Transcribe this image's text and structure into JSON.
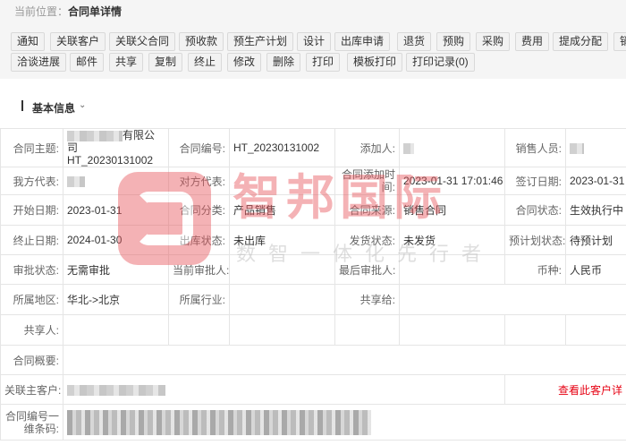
{
  "breadcrumb": {
    "prefix": "当前位置：",
    "current": "合同单详情"
  },
  "toolbar": {
    "row1": [
      "通知",
      "关联客户",
      "关联父合同",
      "预收款",
      "预生产计划",
      "设计",
      "出库申请",
      "退货",
      "预购",
      "采购",
      "费用",
      "提成分配",
      "销"
    ],
    "row2": [
      "洽谈进展",
      "邮件",
      "共享",
      "复制",
      "终止",
      "修改",
      "删除",
      "打印",
      "模板打印",
      "打印记录(0)"
    ]
  },
  "section": {
    "title": "基本信息",
    "chevron": "chevron-down-icon"
  },
  "fields": {
    "subject": {
      "label": "合同主题:",
      "value_visible": "有限公司",
      "value_line2": "HT_20230131002"
    },
    "contract_no": {
      "label": "合同编号:",
      "value": "HT_20230131002"
    },
    "creator": {
      "label": "添加人:"
    },
    "sales_person": {
      "label": "销售人员:"
    },
    "our_rep": {
      "label": "我方代表:"
    },
    "their_rep": {
      "label": "对方代表:"
    },
    "add_time": {
      "label": "合同添加时间:",
      "value": "2023-01-31 17:01:46"
    },
    "sign_date": {
      "label": "签订日期:",
      "value": "2023-01-31"
    },
    "start_date": {
      "label": "开始日期:",
      "value": "2023-01-31"
    },
    "category": {
      "label": "合同分类:",
      "value": "产品销售"
    },
    "source": {
      "label": "合同来源:",
      "value": "销售合同"
    },
    "status": {
      "label": "合同状态:",
      "value": "生效执行中"
    },
    "end_date": {
      "label": "终止日期:",
      "value": "2024-01-30"
    },
    "outbound_status": {
      "label": "出库状态:",
      "value": "未出库"
    },
    "shipping_status": {
      "label": "发货状态:",
      "value": "未发货"
    },
    "plan_status": {
      "label": "预计划状态:",
      "value": "待预计划"
    },
    "approval_status": {
      "label": "审批状态:",
      "value": "无需审批"
    },
    "current_approver": {
      "label": "当前审批人:",
      "value": ""
    },
    "last_approver": {
      "label": "最后审批人:",
      "value": ""
    },
    "currency": {
      "label": "币种:",
      "value": "人民币"
    },
    "region": {
      "label": "所属地区:",
      "value": "华北->北京"
    },
    "industry": {
      "label": "所属行业:",
      "value": ""
    },
    "shared_to": {
      "label": "共享给:",
      "value": ""
    },
    "sharer": {
      "label": "共享人:",
      "value": ""
    },
    "overview": {
      "label": "合同概要:",
      "value": ""
    },
    "main_customer": {
      "label": "关联主客户:",
      "link": "查看此客户详"
    },
    "barcode": {
      "label": "合同编号一维条码:"
    }
  },
  "watermark": {
    "title": "智邦国际",
    "slogan": "数智一体化先行者"
  },
  "colors": {
    "accent_red": "#e60012",
    "watermark_red": "#e8565c",
    "bar_bg": "#f5f5f5"
  }
}
